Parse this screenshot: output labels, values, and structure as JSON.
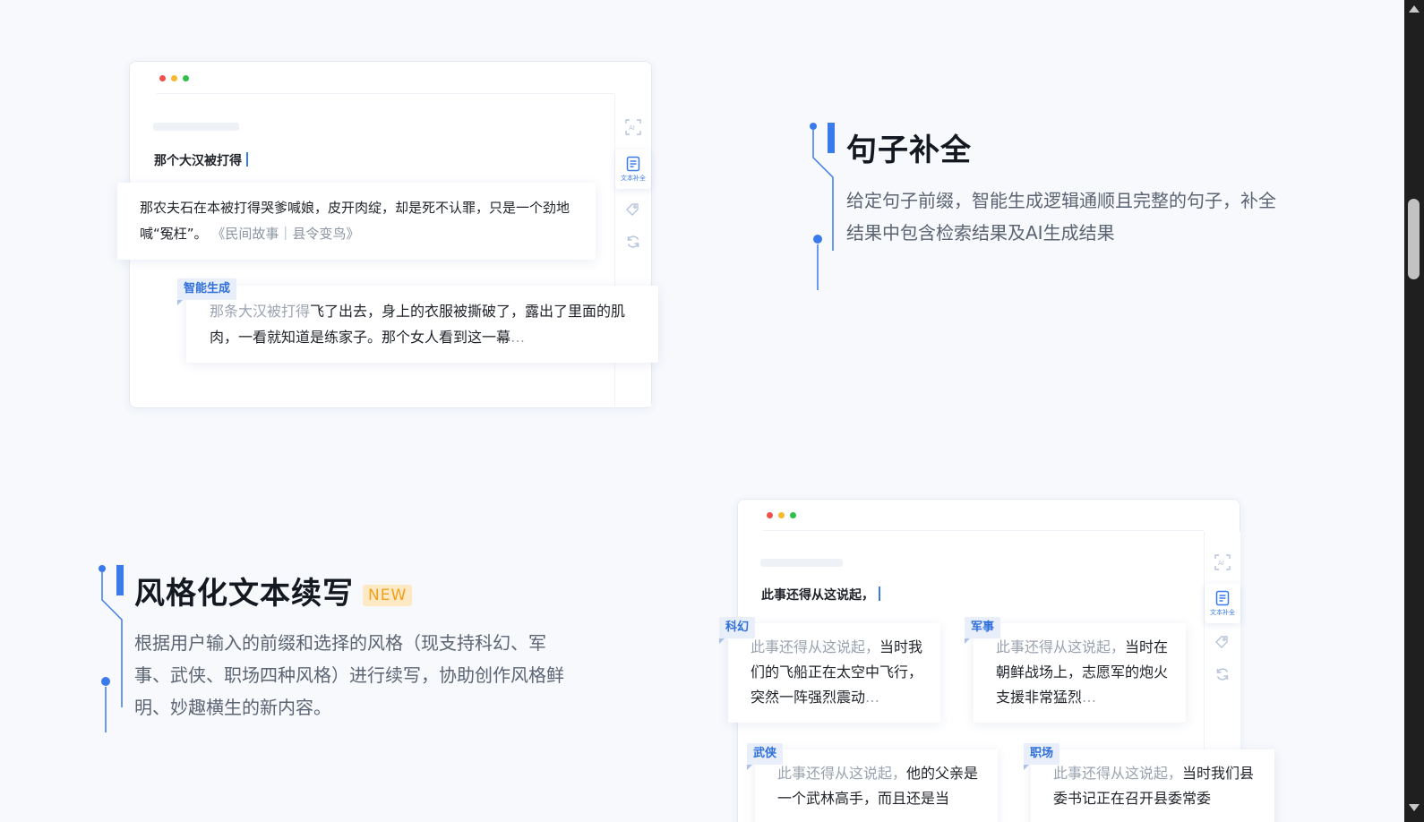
{
  "sentence_completion": {
    "title": "句子补全",
    "description": "给定句子前缀，智能生成逻辑通顺且完整的句子，补全结果中包含检索结果及AI生成结果",
    "demo": {
      "prompt": "那个大汉被打得",
      "toolbar": {
        "items": [
          {
            "icon": "ai-scan-icon"
          },
          {
            "icon": "text-completion-icon",
            "label": "文本补全",
            "active": true
          },
          {
            "icon": "tag-icon"
          },
          {
            "icon": "refresh-icon"
          }
        ]
      },
      "retrieval_result": {
        "text": "那农夫石在本被打得哭爹喊娘，皮开肉绽，却是死不认罪，只是一个劲地喊“冤枉”。",
        "source": "《民间故事｜县令变鸟》"
      },
      "ai_result": {
        "tag": "智能生成",
        "prefix": "那条大汉被打得",
        "text": "飞了出去，身上的衣服被撕破了，露出了里面的肌肉，一看就知道是练家子。那个女人看到这一幕",
        "ellipsis": "…"
      }
    }
  },
  "style_continuation": {
    "title": "风格化文本续写",
    "badge": "NEW",
    "description": "根据用户输入的前缀和选择的风格（现支持科幻、军事、武侠、职场四种风格）进行续写，协助创作风格鲜明、妙趣横生的新内容。",
    "demo": {
      "prompt": "此事还得从这说起，",
      "cards": [
        {
          "tag": "科幻",
          "prefix": "此事还得从这说起，",
          "text": "当时我们的飞船正在太空中飞行，突然一阵强烈震动",
          "ellipsis": "…"
        },
        {
          "tag": "军事",
          "prefix": "此事还得从这说起，",
          "text": "当时在朝鲜战场上，志愿军的炮火支援非常猛烈",
          "ellipsis": "…"
        },
        {
          "tag": "武侠",
          "prefix": "此事还得从这说起，",
          "text": "他的父亲是一个武林高手，而且还是当",
          "ellipsis": ""
        },
        {
          "tag": "职场",
          "prefix": "此事还得从这说起，",
          "text": "当时我们县委书记正在召开县委常委",
          "ellipsis": ""
        }
      ]
    }
  },
  "colors": {
    "accent": "#3a7bec",
    "badge_bg": "#fde9c4",
    "badge_fg": "#f0a020"
  }
}
